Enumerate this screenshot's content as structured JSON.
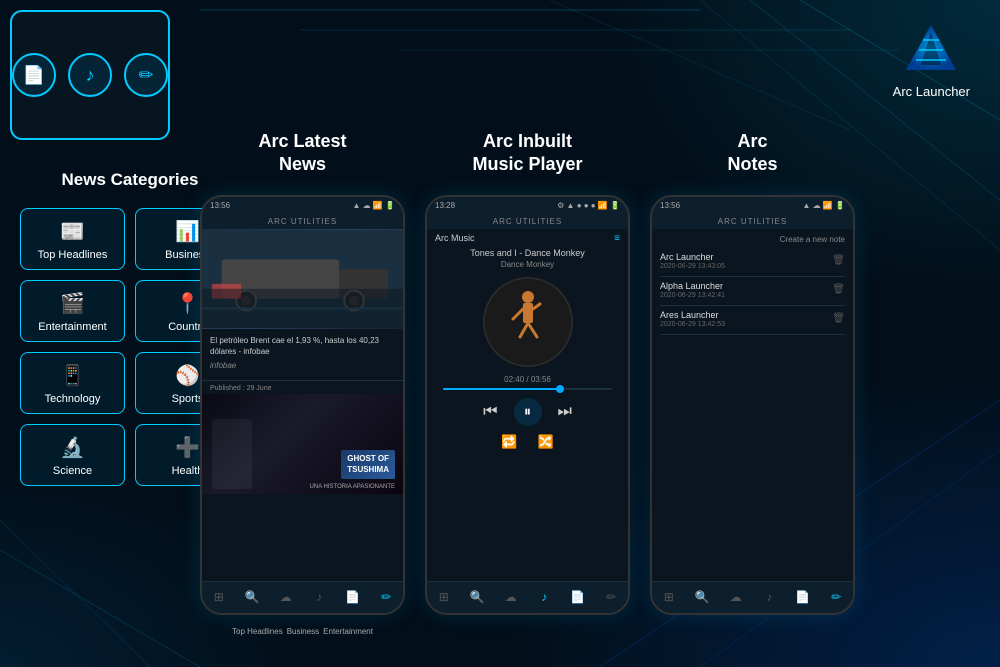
{
  "app": {
    "name": "Arc Launcher",
    "background_color": "#020f1a"
  },
  "logo": {
    "name": "Arc Launcher",
    "line1": "Arc",
    "line2": "Launcher"
  },
  "top_phone_icons": [
    {
      "icon": "📄",
      "name": "document"
    },
    {
      "icon": "🎵",
      "name": "music"
    },
    {
      "icon": "✏️",
      "name": "edit"
    }
  ],
  "news_categories": {
    "title": "News Categories",
    "items": [
      {
        "label": "Top Headlines",
        "icon": "📰"
      },
      {
        "label": "Business",
        "icon": "📊"
      },
      {
        "label": "Entertainment",
        "icon": "🎬"
      },
      {
        "label": "Country",
        "icon": "📍"
      },
      {
        "label": "Technology",
        "icon": "📱"
      },
      {
        "label": "Sports",
        "icon": "⚾"
      },
      {
        "label": "Science",
        "icon": "🔬"
      },
      {
        "label": "Health",
        "icon": "➕"
      }
    ]
  },
  "sections": [
    {
      "title": "Arc Latest\nNews",
      "title_line1": "Arc Latest",
      "title_line2": "News"
    },
    {
      "title": "Arc Inbuilt\nMusic Player",
      "title_line1": "Arc Inbuilt",
      "title_line2": "Music Player"
    },
    {
      "title": "Arc\nNotes",
      "title_line1": "Arc",
      "title_line2": "Notes"
    }
  ],
  "news_phone": {
    "status_time": "13:56",
    "header": "ARC UTILITIES",
    "article1": {
      "headline": "El petróleo Brent cae el 1,93 %, hasta los 40,23 dólares - infobae",
      "source": "infobae"
    },
    "article2": {
      "published": "Published : 29 June",
      "title": "GHOST OF\nTSUSHIMA",
      "subtitle": "UNA HISTORIA APASIONANTE"
    },
    "bottom_nav": [
      "⊞",
      "🔍",
      "☁",
      "♪",
      "📄",
      "✏️"
    ]
  },
  "music_phone": {
    "status_time": "13:28",
    "header": "ARC UTILITIES",
    "section_title": "Arc Music",
    "track_name": "Tones and I - Dance Monkey",
    "album_name": "Dance Monkey",
    "time_current": "02:40",
    "time_total": "03:56",
    "progress_pct": 70,
    "bottom_nav": [
      "⊞",
      "🔍",
      "☁",
      "♪",
      "📄",
      "✏️"
    ]
  },
  "notes_phone": {
    "status_time": "13:56",
    "header": "ARC UTILITIES",
    "create_label": "Create a new note",
    "notes": [
      {
        "title": "Arc Launcher",
        "date": "2020-06-29 13:43:05"
      },
      {
        "title": "Alpha Launcher",
        "date": "2020-06-29 13:42:41"
      },
      {
        "title": "Ares Launcher",
        "date": "2020-06-29 13:42:53"
      }
    ],
    "bottom_nav": [
      "⊞",
      "🔍",
      "☁",
      "♪",
      "📄",
      "✏️"
    ]
  }
}
